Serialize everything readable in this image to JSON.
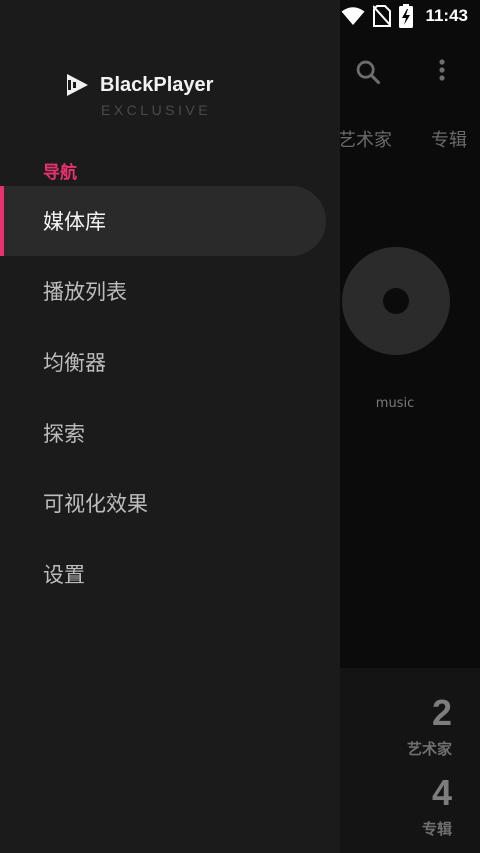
{
  "status_bar": {
    "time": "11:43"
  },
  "drawer": {
    "brand": {
      "name": "BlackPlayer",
      "subtitle": "EXCLUSIVE"
    },
    "section_title": "导航",
    "items": [
      {
        "label": "媒体库",
        "active": true
      },
      {
        "label": "播放列表",
        "active": false
      },
      {
        "label": "均衡器",
        "active": false
      },
      {
        "label": "探索",
        "active": false
      },
      {
        "label": "可视化效果",
        "active": false
      },
      {
        "label": "设置",
        "active": false
      }
    ]
  },
  "background": {
    "tabs": [
      "艺术家",
      "专辑"
    ],
    "folder_label": "music",
    "stats": [
      {
        "value": "2",
        "label": "艺术家"
      },
      {
        "value": "4",
        "label": "专辑"
      }
    ]
  },
  "icons": {
    "toolbar": [
      "search-icon",
      "more-vert-icon"
    ],
    "status": [
      "wifi-icon",
      "no-sim-icon",
      "battery-charging-icon"
    ],
    "brand": "play-logo-icon"
  },
  "colors": {
    "accent": "#e8326e",
    "drawer_bg": "#1b1b1b",
    "active_item_bg": "#2a2a2a"
  }
}
